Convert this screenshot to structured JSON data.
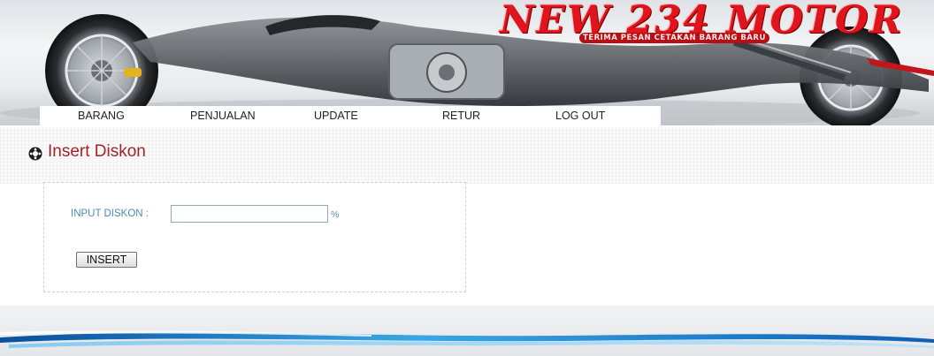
{
  "header": {
    "brand_title": "NEW 234 MOTOR",
    "brand_tagline": "TERIMA PESAN CETAKAN BARANG BARU"
  },
  "nav": {
    "items": [
      {
        "label": "BARANG"
      },
      {
        "label": "PENJUALAN"
      },
      {
        "label": "UPDATE"
      },
      {
        "label": "RETUR"
      },
      {
        "label": "LOG OUT"
      }
    ]
  },
  "section": {
    "title": "Insert Diskon"
  },
  "form": {
    "diskon_label": "INPUT DISKON :",
    "diskon_value": "",
    "percent_label": "%",
    "insert_label": "INSERT"
  },
  "colors": {
    "brand_red": "#e0141c",
    "title_red": "#a1232a",
    "label_blue": "#4a8db4",
    "footer_wave": "#1d72c6"
  }
}
